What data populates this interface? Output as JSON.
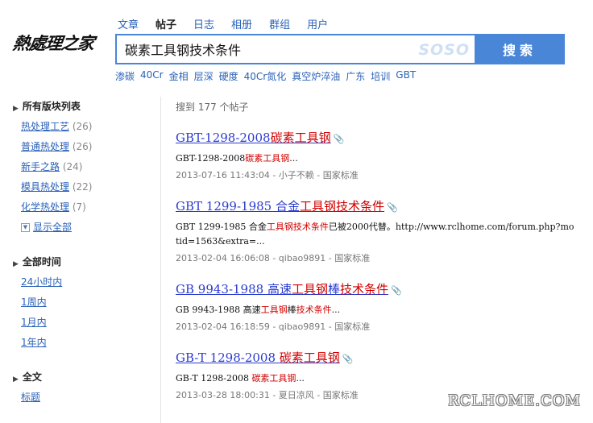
{
  "logo": {
    "text": "熱處理之家"
  },
  "nav": {
    "tabs": [
      {
        "label": "文章"
      },
      {
        "label": "帖子"
      },
      {
        "label": "日志"
      },
      {
        "label": "相册"
      },
      {
        "label": "群组"
      },
      {
        "label": "用户"
      }
    ],
    "active": "帖子"
  },
  "search": {
    "query": "碳素工具钢技术条件",
    "brand": "SOSO",
    "button": "搜索"
  },
  "hot_keywords": [
    "渗碳",
    "40Cr",
    "金相",
    "层深",
    "硬度",
    "40Cr氮化",
    "真空炉淬油",
    "广东",
    "培训",
    "GBT"
  ],
  "sidebar": {
    "boards": {
      "title": "所有版块列表",
      "items": [
        {
          "label": "热处理工艺",
          "count": "(26)"
        },
        {
          "label": "普通热处理",
          "count": "(26)"
        },
        {
          "label": "新手之路",
          "count": "(24)"
        },
        {
          "label": "模具热处理",
          "count": "(22)"
        },
        {
          "label": "化学热处理",
          "count": "(7)"
        }
      ],
      "show_all": "显示全部"
    },
    "time": {
      "title": "全部时间",
      "items": [
        "24小时内",
        "1周内",
        "1月内",
        "1年内"
      ]
    },
    "scope": {
      "title": "全文",
      "items": [
        "标题"
      ]
    }
  },
  "results": {
    "count_text": "搜到 177 个帖子",
    "items": [
      {
        "title_parts": [
          {
            "t": "GBT-1298-2008",
            "h": false
          },
          {
            "t": "碳素工具钢",
            "h": true
          }
        ],
        "snippet_lines": [
          [
            {
              "t": "GBT-1298-2008",
              "h": false
            },
            {
              "t": "碳素工具钢",
              "h": true
            },
            {
              "t": "...",
              "h": false
            }
          ]
        ],
        "meta": "2013-07-16 11:43:04 - 小子不赖 - 国家标准"
      },
      {
        "title_parts": [
          {
            "t": "GBT 1299-1985 合金",
            "h": false
          },
          {
            "t": "工具钢技术条件",
            "h": true
          }
        ],
        "snippet_lines": [
          [
            {
              "t": "GBT 1299-1985 合金",
              "h": false
            },
            {
              "t": "工具钢技术条件",
              "h": true
            },
            {
              "t": "已被2000代替。http://www.rclhome.com/forum.php?mo",
              "h": false
            }
          ],
          [
            {
              "t": "tid=1563&extra=...",
              "h": false
            }
          ]
        ],
        "meta": "2013-02-04 16:06:08 - qibao9891 - 国家标准"
      },
      {
        "title_parts": [
          {
            "t": "GB 9943-1988 高速",
            "h": false
          },
          {
            "t": "工具钢",
            "h": true
          },
          {
            "t": "棒",
            "h": false
          },
          {
            "t": "技术条件",
            "h": true
          }
        ],
        "snippet_lines": [
          [
            {
              "t": "GB 9943-1988 高速",
              "h": false
            },
            {
              "t": "工具钢",
              "h": true
            },
            {
              "t": "棒",
              "h": false
            },
            {
              "t": "技术条件",
              "h": true
            },
            {
              "t": "...",
              "h": false
            }
          ]
        ],
        "meta": "2013-02-04 16:18:59 - qibao9891 - 国家标准"
      },
      {
        "title_parts": [
          {
            "t": "GB-T 1298-2008 ",
            "h": false
          },
          {
            "t": "碳素工具钢",
            "h": true
          }
        ],
        "snippet_lines": [
          [
            {
              "t": "GB-T 1298-2008 ",
              "h": false
            },
            {
              "t": "碳素工具钢",
              "h": true
            },
            {
              "t": "...",
              "h": false
            }
          ]
        ],
        "meta": "2013-03-28 18:00:31 - 夏日凉风 - 国家标准"
      }
    ]
  },
  "watermark": "RCLHOME.COM",
  "colors": {
    "accent": "#4a86d8",
    "link": "#2a62b8",
    "highlight": "#d00000",
    "title_link": "#2a3bd0"
  }
}
